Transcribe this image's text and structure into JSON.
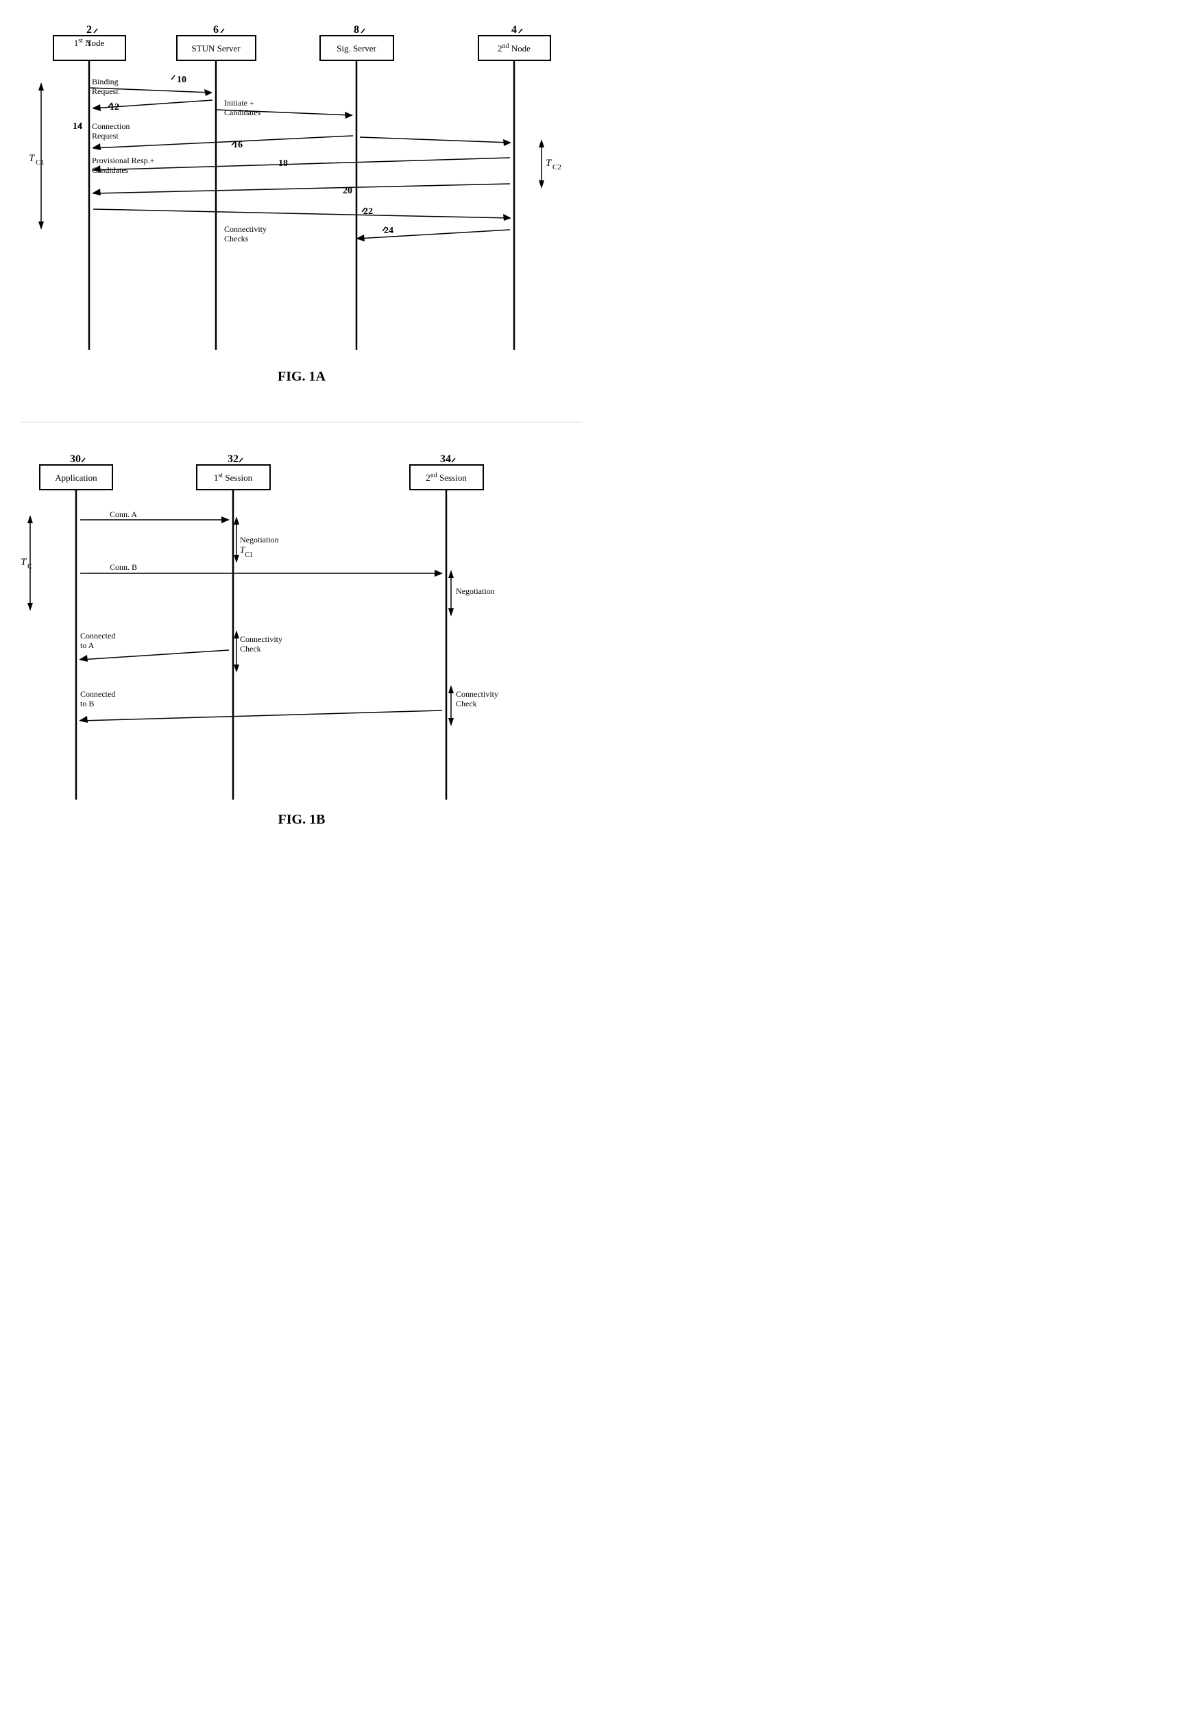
{
  "fig1a": {
    "title": "FIG. 1A",
    "nodes": [
      {
        "id": "n2",
        "label": "1st Node",
        "superscript": "st",
        "number": "2"
      },
      {
        "id": "n6",
        "label": "STUN Server",
        "number": "6"
      },
      {
        "id": "n8",
        "label": "Sig. Server",
        "number": "8"
      },
      {
        "id": "n4",
        "label": "2nd Node",
        "superscript": "nd",
        "number": "4"
      }
    ],
    "labels": {
      "binding_request": "Binding\nRequest",
      "arrow10": "10",
      "arrow12": "12",
      "initiate_candidates": "Initiate +\nCandidates",
      "arrow14": "14",
      "connection_request": "Connection\nRequest",
      "arrow16": "16",
      "arrow18": "18",
      "provisional": "Provisional Resp.+\nCandidates",
      "arrow20": "20",
      "arrow22": "22",
      "arrow24": "24",
      "connectivity_checks": "Connectivity\nChecks",
      "tc1": "T",
      "tc1_sub": "C1",
      "tc2": "T",
      "tc2_sub": "C2"
    }
  },
  "fig1b": {
    "title": "FIG. 1B",
    "nodes": [
      {
        "id": "n30",
        "label": "Application",
        "number": "30"
      },
      {
        "id": "n32",
        "label": "1st Session",
        "superscript": "st",
        "number": "32"
      },
      {
        "id": "n34",
        "label": "2nd Session",
        "superscript": "nd",
        "number": "34"
      }
    ],
    "labels": {
      "conn_a": "Conn. A",
      "conn_b": "Conn. B",
      "negotiation": "Negotiation",
      "tc1": "T",
      "tc1_sub": "C1",
      "connectivity_check": "Connectivity\nCheck",
      "connected_to_a": "Connected\nto A",
      "connected_to_b": "Connected\nto B",
      "negotiation2": "Negotiation",
      "connectivity_check2": "Connectivity\nCheck",
      "tc": "T",
      "tc_sub": "C"
    }
  }
}
